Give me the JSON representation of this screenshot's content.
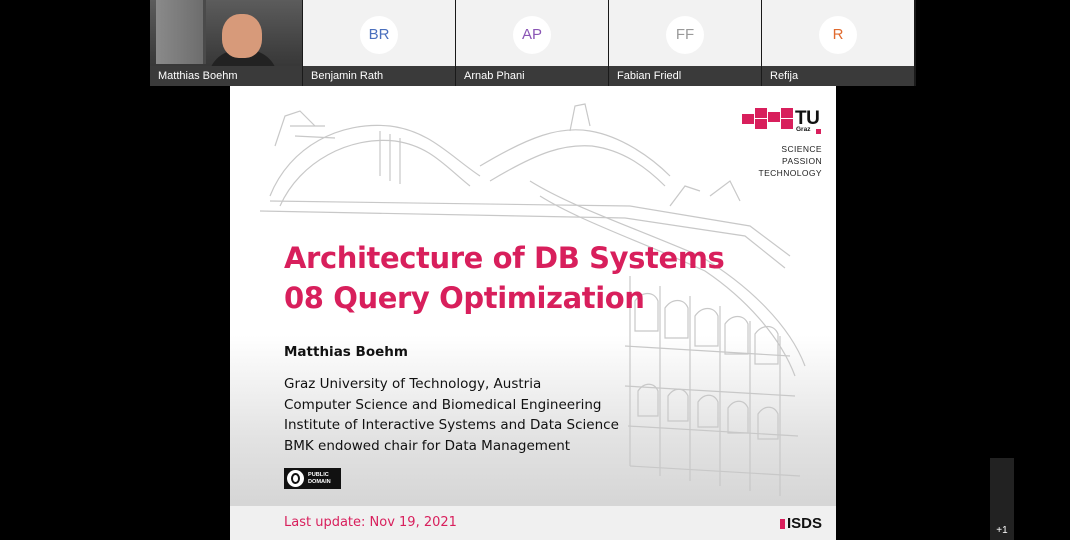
{
  "participants": [
    {
      "name": "Matthias Boehm",
      "initials": "",
      "video": true
    },
    {
      "name": "Benjamin Rath",
      "initials": "BR",
      "color": "#4a6fbd"
    },
    {
      "name": "Arnab Phani",
      "initials": "AP",
      "color": "#8a55b5"
    },
    {
      "name": "Fabian Friedl",
      "initials": "FF",
      "color": "#9a9a9a"
    },
    {
      "name": "Refija",
      "initials": "R",
      "color": "#e06a2e"
    }
  ],
  "slide": {
    "title_line1": "Architecture of DB Systems",
    "title_line2": "08 Query Optimization",
    "author": "Matthias Boehm",
    "affiliation": [
      "Graz University of Technology, Austria",
      "Computer Science and Biomedical Engineering",
      "Institute of Interactive Systems and Data Science",
      "BMK endowed chair for Data Management"
    ],
    "license_line1": "PUBLIC",
    "license_line2": "DOMAIN",
    "last_update": "Last update: Nov 19, 2021",
    "logo_letters": "TU",
    "logo_sub": "Graz",
    "tagline": [
      "SCIENCE",
      "PASSION",
      "TECHNOLOGY"
    ],
    "footer_logo": "ISDS",
    "accent_color": "#d81f5c"
  },
  "overflow_label": "+1"
}
